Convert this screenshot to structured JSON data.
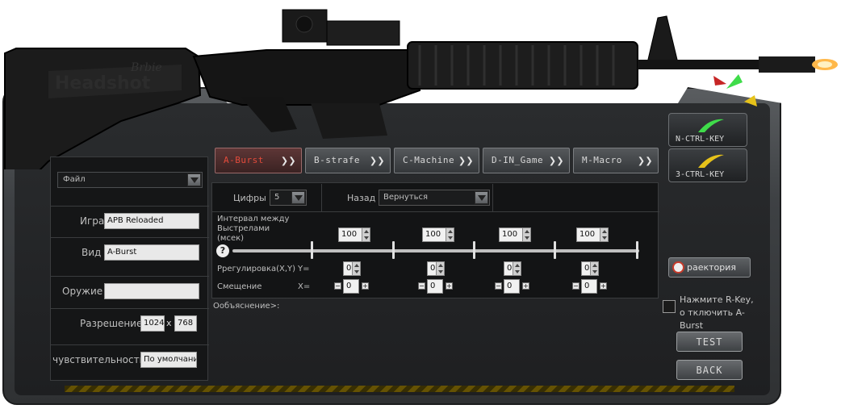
{
  "branding": {
    "engraving": "Headshot",
    "engraving_small": "Brbie"
  },
  "left": {
    "file_menu": "Файл",
    "rows": {
      "game": {
        "label": "Игра",
        "value": "APB Reloaded"
      },
      "view": {
        "label": "Вид",
        "value": "A-Burst"
      },
      "weapon": {
        "label": "Оружие",
        "value": ""
      },
      "resolution": {
        "label": "Разрешение",
        "width": "1024",
        "sep": "x",
        "height": "768"
      },
      "sensitivity": {
        "label": "чувствительность",
        "value": "По умолчани"
      }
    }
  },
  "tabs": [
    {
      "label": "A-Burst",
      "active": true
    },
    {
      "label": "B-strafe",
      "active": false
    },
    {
      "label": "C-Machine",
      "active": false
    },
    {
      "label": "D-IN_Game",
      "active": false
    },
    {
      "label": "M-Macro",
      "active": false
    }
  ],
  "center": {
    "digits_label": "Цифры",
    "digits_value": "5",
    "back_label": "Назад",
    "back_value": "Вернуться",
    "interval_label_1": "Интервал между",
    "interval_label_2": "Выстрелами",
    "interval_label_3": "(мсек)",
    "intervals": [
      "100",
      "100",
      "100",
      "100"
    ],
    "adjust_label": "Ррегулировка(X,Y)",
    "y_label": "Y=",
    "offset_label": "Смещение",
    "x_label": "X=",
    "y_values": [
      "0",
      "0",
      "0",
      "0"
    ],
    "x_values": [
      "0",
      "0",
      "0",
      "0"
    ],
    "explanation": "Ообъяснение>:"
  },
  "right": {
    "key_n": "N-CTRL-KEY",
    "key_3": "3-CTRL-KEY",
    "trajectory": "раектория",
    "hint": "Нажмите R-Key, о тключить A-Burst",
    "test": "TEST",
    "back": "BACK"
  },
  "colors": {
    "active_tab_text": "#e34b3b",
    "n_key_glow": "#3fdc4a",
    "key3_glow": "#e6c21a",
    "muzzle_flash": "#ffb84a",
    "hazard_yellow": "#6d5800"
  }
}
